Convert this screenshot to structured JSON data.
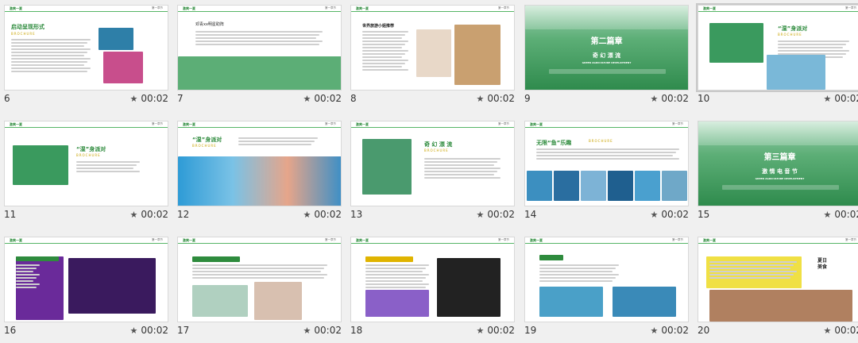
{
  "slides": [
    {
      "num": "6",
      "duration": "00:02",
      "title": "启动呈现形式",
      "subtitle": "BROCHURE"
    },
    {
      "num": "7",
      "duration": "00:02",
      "title": "邓青xx明星助阵"
    },
    {
      "num": "8",
      "duration": "00:02",
      "title": "世界旅游小姐推荐"
    },
    {
      "num": "9",
      "duration": "00:02",
      "title": "第二篇章",
      "subtitle": "奇 幻 漂 流",
      "caption": "GREEN AGRICULTURE DEVELOPMENT"
    },
    {
      "num": "10",
      "duration": "00:02",
      "title": "“湿”身派对",
      "subtitle": "BROCHURE"
    },
    {
      "num": "11",
      "duration": "00:02",
      "title": "“湿”身派对",
      "subtitle": "BROCHURE"
    },
    {
      "num": "12",
      "duration": "00:02",
      "title": "“湿”身派对",
      "subtitle": "BROCHURE"
    },
    {
      "num": "13",
      "duration": "00:02",
      "title": "奇 幻 漂 流",
      "subtitle": "BROCHURE"
    },
    {
      "num": "14",
      "duration": "00:02",
      "title": "无限“鱼”乐趣",
      "subtitle": "BROCHURE"
    },
    {
      "num": "15",
      "duration": "00:02",
      "title": "第三篇章",
      "subtitle": "激 情 电 音 节",
      "caption": "GREEN AGRICULTURE DEVELOPMENT"
    },
    {
      "num": "16",
      "duration": "00:02",
      "title": "激情电音节"
    },
    {
      "num": "17",
      "duration": "00:02",
      "title": "比基尼美女游泳秀"
    },
    {
      "num": "18",
      "duration": "00:02",
      "title": "激情电音节"
    },
    {
      "num": "19",
      "duration": "00:02",
      "title": "冲浪"
    },
    {
      "num": "20",
      "duration": "00:02",
      "title": "夏日美食"
    }
  ],
  "header": {
    "tag": "激爽一夏",
    "sub": "xx水上乐园",
    "meta": "第一章节"
  },
  "colors": {
    "accent": "#56b566",
    "gold": "#e0b400"
  }
}
